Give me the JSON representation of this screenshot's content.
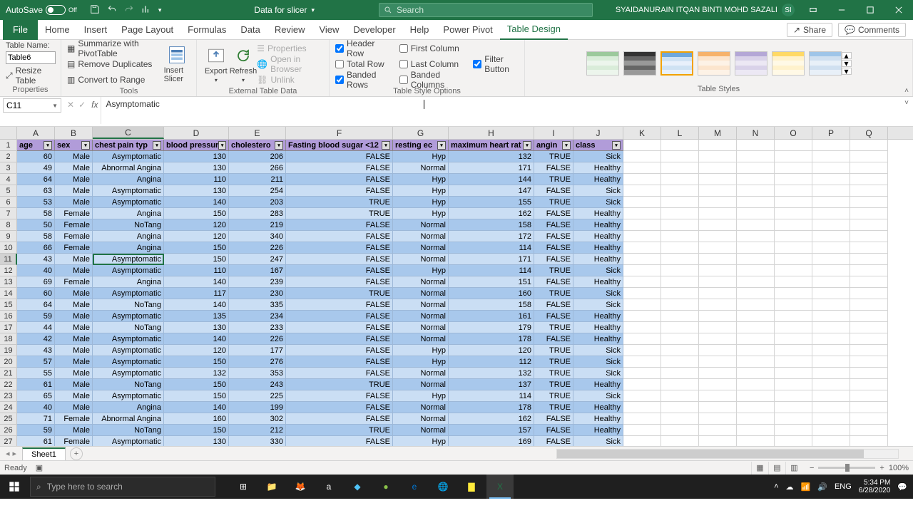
{
  "titlebar": {
    "autosave_label": "AutoSave",
    "autosave_state": "Off",
    "filename": "Data for slicer",
    "search_placeholder": "Search",
    "username": "SYAIDANURAIN ITQAN BINTI MOHD SAZALI",
    "user_initials": "SI"
  },
  "tabs": [
    "File",
    "Home",
    "Insert",
    "Page Layout",
    "Formulas",
    "Data",
    "Review",
    "View",
    "Developer",
    "Help",
    "Power Pivot",
    "Table Design"
  ],
  "active_tab": "Table Design",
  "share_label": "Share",
  "comments_label": "Comments",
  "ribbon": {
    "properties": {
      "label": "Properties",
      "name_label": "Table Name:",
      "name_value": "Table6",
      "resize": "Resize Table"
    },
    "tools": {
      "label": "Tools",
      "pivot": "Summarize with PivotTable",
      "dupes": "Remove Duplicates",
      "range": "Convert to Range",
      "slicer": "Insert Slicer"
    },
    "external": {
      "label": "External Table Data",
      "export": "Export",
      "refresh": "Refresh",
      "props": "Properties",
      "browser": "Open in Browser",
      "unlink": "Unlink"
    },
    "options": {
      "label": "Table Style Options",
      "header_row": "Header Row",
      "total_row": "Total Row",
      "banded_rows": "Banded Rows",
      "first_col": "First Column",
      "last_col": "Last Column",
      "banded_cols": "Banded Columns",
      "filter": "Filter Button"
    },
    "styles": {
      "label": "Table Styles"
    }
  },
  "namebox": "C11",
  "formula": "Asymptomatic",
  "columns": [
    {
      "letter": "A",
      "w": 53,
      "label": "age",
      "align": "r"
    },
    {
      "letter": "B",
      "w": 53,
      "label": "sex",
      "align": "r"
    },
    {
      "letter": "C",
      "w": 100,
      "label": "chest pain typ",
      "align": "r"
    },
    {
      "letter": "D",
      "w": 91,
      "label": "blood pressur",
      "align": "r"
    },
    {
      "letter": "E",
      "w": 80,
      "label": "cholestero",
      "align": "r"
    },
    {
      "letter": "F",
      "w": 150,
      "label": "Fasting blood sugar <12",
      "align": "r"
    },
    {
      "letter": "G",
      "w": 78,
      "label": "resting ec",
      "align": "r"
    },
    {
      "letter": "H",
      "w": 120,
      "label": "maximum heart rat",
      "align": "r"
    },
    {
      "letter": "I",
      "w": 55,
      "label": "angin",
      "align": "r"
    },
    {
      "letter": "J",
      "w": 70,
      "label": "class",
      "align": "r"
    }
  ],
  "extra_cols": [
    "K",
    "L",
    "M",
    "N",
    "O",
    "P",
    "Q"
  ],
  "extra_w": 53,
  "table_rows": [
    [
      60,
      "Male",
      "Asymptomatic",
      130,
      206,
      "FALSE",
      "Hyp",
      132,
      "TRUE",
      "Sick"
    ],
    [
      49,
      "Male",
      "Abnormal Angina",
      130,
      266,
      "FALSE",
      "Normal",
      171,
      "FALSE",
      "Healthy"
    ],
    [
      64,
      "Male",
      "Angina",
      110,
      211,
      "FALSE",
      "Hyp",
      144,
      "TRUE",
      "Healthy"
    ],
    [
      63,
      "Male",
      "Asymptomatic",
      130,
      254,
      "FALSE",
      "Hyp",
      147,
      "FALSE",
      "Sick"
    ],
    [
      53,
      "Male",
      "Asymptomatic",
      140,
      203,
      "TRUE",
      "Hyp",
      155,
      "TRUE",
      "Sick"
    ],
    [
      58,
      "Female",
      "Angina",
      150,
      283,
      "TRUE",
      "Hyp",
      162,
      "FALSE",
      "Healthy"
    ],
    [
      50,
      "Female",
      "NoTang",
      120,
      219,
      "FALSE",
      "Normal",
      158,
      "FALSE",
      "Healthy"
    ],
    [
      58,
      "Female",
      "Angina",
      120,
      340,
      "FALSE",
      "Normal",
      172,
      "FALSE",
      "Healthy"
    ],
    [
      66,
      "Female",
      "Angina",
      150,
      226,
      "FALSE",
      "Normal",
      114,
      "FALSE",
      "Healthy"
    ],
    [
      43,
      "Male",
      "Asymptomatic",
      150,
      247,
      "FALSE",
      "Normal",
      171,
      "FALSE",
      "Healthy"
    ],
    [
      40,
      "Male",
      "Asymptomatic",
      110,
      167,
      "FALSE",
      "Hyp",
      114,
      "TRUE",
      "Sick"
    ],
    [
      69,
      "Female",
      "Angina",
      140,
      239,
      "FALSE",
      "Normal",
      151,
      "FALSE",
      "Healthy"
    ],
    [
      60,
      "Male",
      "Asymptomatic",
      117,
      230,
      "TRUE",
      "Normal",
      160,
      "TRUE",
      "Sick"
    ],
    [
      64,
      "Male",
      "NoTang",
      140,
      335,
      "FALSE",
      "Normal",
      158,
      "FALSE",
      "Sick"
    ],
    [
      59,
      "Male",
      "Asymptomatic",
      135,
      234,
      "FALSE",
      "Normal",
      161,
      "FALSE",
      "Healthy"
    ],
    [
      44,
      "Male",
      "NoTang",
      130,
      233,
      "FALSE",
      "Normal",
      179,
      "TRUE",
      "Healthy"
    ],
    [
      42,
      "Male",
      "Asymptomatic",
      140,
      226,
      "FALSE",
      "Normal",
      178,
      "FALSE",
      "Healthy"
    ],
    [
      43,
      "Male",
      "Asymptomatic",
      120,
      177,
      "FALSE",
      "Hyp",
      120,
      "TRUE",
      "Sick"
    ],
    [
      57,
      "Male",
      "Asymptomatic",
      150,
      276,
      "FALSE",
      "Hyp",
      112,
      "TRUE",
      "Sick"
    ],
    [
      55,
      "Male",
      "Asymptomatic",
      132,
      353,
      "FALSE",
      "Normal",
      132,
      "TRUE",
      "Sick"
    ],
    [
      61,
      "Male",
      "NoTang",
      150,
      243,
      "TRUE",
      "Normal",
      137,
      "TRUE",
      "Healthy"
    ],
    [
      65,
      "Male",
      "Asymptomatic",
      150,
      225,
      "FALSE",
      "Hyp",
      114,
      "TRUE",
      "Sick"
    ],
    [
      40,
      "Male",
      "Angina",
      140,
      199,
      "FALSE",
      "Normal",
      178,
      "TRUE",
      "Healthy"
    ],
    [
      71,
      "Female",
      "Abnormal Angina",
      160,
      302,
      "FALSE",
      "Normal",
      162,
      "FALSE",
      "Healthy"
    ],
    [
      59,
      "Male",
      "NoTang",
      150,
      212,
      "TRUE",
      "Normal",
      157,
      "FALSE",
      "Healthy"
    ],
    [
      61,
      "Female",
      "Asymptomatic",
      130,
      330,
      "FALSE",
      "Hyp",
      169,
      "FALSE",
      "Sick"
    ]
  ],
  "active_cell": {
    "row": 11,
    "col": 2
  },
  "sheet": {
    "name": "Sheet1"
  },
  "status": {
    "ready": "Ready",
    "zoom": "100%"
  },
  "taskbar": {
    "search": "Type here to search",
    "time": "5:34 PM",
    "date": "6/28/2020"
  }
}
